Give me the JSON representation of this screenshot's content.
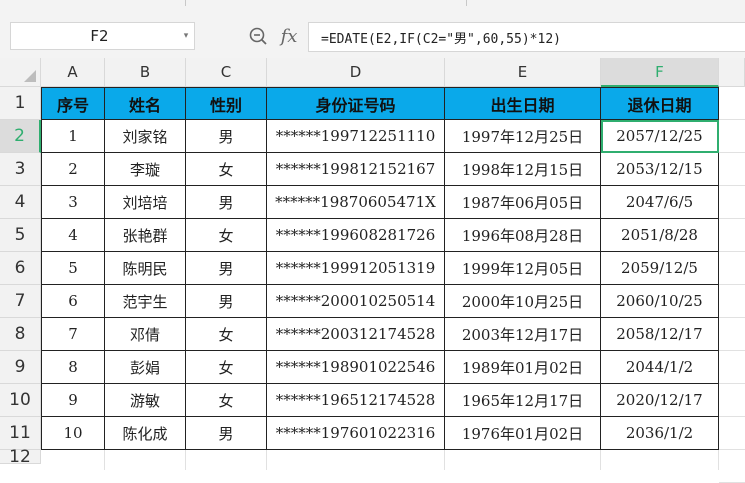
{
  "formula_bar": {
    "name_box": "F2",
    "name_box_arrow": "▾",
    "zoom_icon": "zoom-icon",
    "fx_label": "fx",
    "formula": "=EDATE(E2,IF(C2=\"男\",60,55)*12)"
  },
  "columns": [
    "A",
    "B",
    "C",
    "D",
    "E",
    "F"
  ],
  "selected_column": "F",
  "row_numbers": [
    "1",
    "2",
    "3",
    "4",
    "5",
    "6",
    "7",
    "8",
    "9",
    "10",
    "11",
    "12"
  ],
  "selected_row": "2",
  "header": [
    "序号",
    "姓名",
    "性别",
    "身份证号码",
    "出生日期",
    "退休日期"
  ],
  "rows": [
    [
      "1",
      "刘家铭",
      "男",
      "******199712251110",
      "1997年12月25日",
      "2057/12/25"
    ],
    [
      "2",
      "李璇",
      "女",
      "******199812152167",
      "1998年12月15日",
      "2053/12/15"
    ],
    [
      "3",
      "刘培培",
      "男",
      "******19870605471X",
      "1987年06月05日",
      "2047/6/5"
    ],
    [
      "4",
      "张艳群",
      "女",
      "******199608281726",
      "1996年08月28日",
      "2051/8/28"
    ],
    [
      "5",
      "陈明民",
      "男",
      "******199912051319",
      "1999年12月05日",
      "2059/12/5"
    ],
    [
      "6",
      "范宇生",
      "男",
      "******200010250514",
      "2000年10月25日",
      "2060/10/25"
    ],
    [
      "7",
      "邓倩",
      "女",
      "******200312174528",
      "2003年12月17日",
      "2058/12/17"
    ],
    [
      "8",
      "彭娟",
      "女",
      "******198901022546",
      "1989年01月02日",
      "2044/1/2"
    ],
    [
      "9",
      "游敏",
      "女",
      "******196512174528",
      "1965年12月17日",
      "2020/12/17"
    ],
    [
      "10",
      "陈化成",
      "男",
      "******197601022316",
      "1976年01月02日",
      "2036/1/2"
    ]
  ],
  "colors": {
    "header_fill": "#0aa9ea",
    "selection": "#2fae6f"
  }
}
